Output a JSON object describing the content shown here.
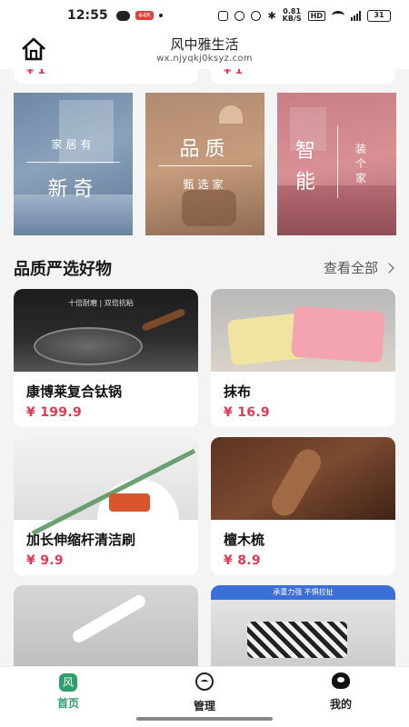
{
  "status_bar": {
    "time": "12:55",
    "app_badge": "44R",
    "net_speed_value": "0.81",
    "net_speed_unit": "KB/S",
    "hd_label": "HD",
    "signal_label": "4G",
    "battery": "31"
  },
  "header": {
    "title": "风中雅生活",
    "url": "wx.njyqkj0ksyz.com"
  },
  "peek_prices": [
    "¥ 1",
    "¥ 1"
  ],
  "banners": [
    {
      "small": "家居有",
      "big": "新奇"
    },
    {
      "big": "品质",
      "small": "甄选家"
    },
    {
      "big_1": "智",
      "big_2": "能",
      "small": "装个家"
    }
  ],
  "section": {
    "title": "品质严选好物",
    "view_all": "查看全部"
  },
  "products": [
    {
      "name": "康博莱复合钛锅",
      "price": "¥ 199.9",
      "thumb_text": "十倍耐磨 | 双倍抗粘"
    },
    {
      "name": "抹布",
      "price": "¥ 16.9"
    },
    {
      "name": "加长伸缩杆清洁刷",
      "price": "¥ 9.9"
    },
    {
      "name": "檀木梳",
      "price": "¥ 8.9"
    },
    {
      "name": "",
      "price": ""
    },
    {
      "name": "",
      "price": "",
      "thumb_text": "承重力强 不惧拉扯"
    }
  ],
  "nav": {
    "home_icon_char": "风",
    "home": "首页",
    "manage": "管理",
    "mine": "我的"
  },
  "colors": {
    "accent": "#2e9e6a",
    "price": "#e13a55"
  }
}
